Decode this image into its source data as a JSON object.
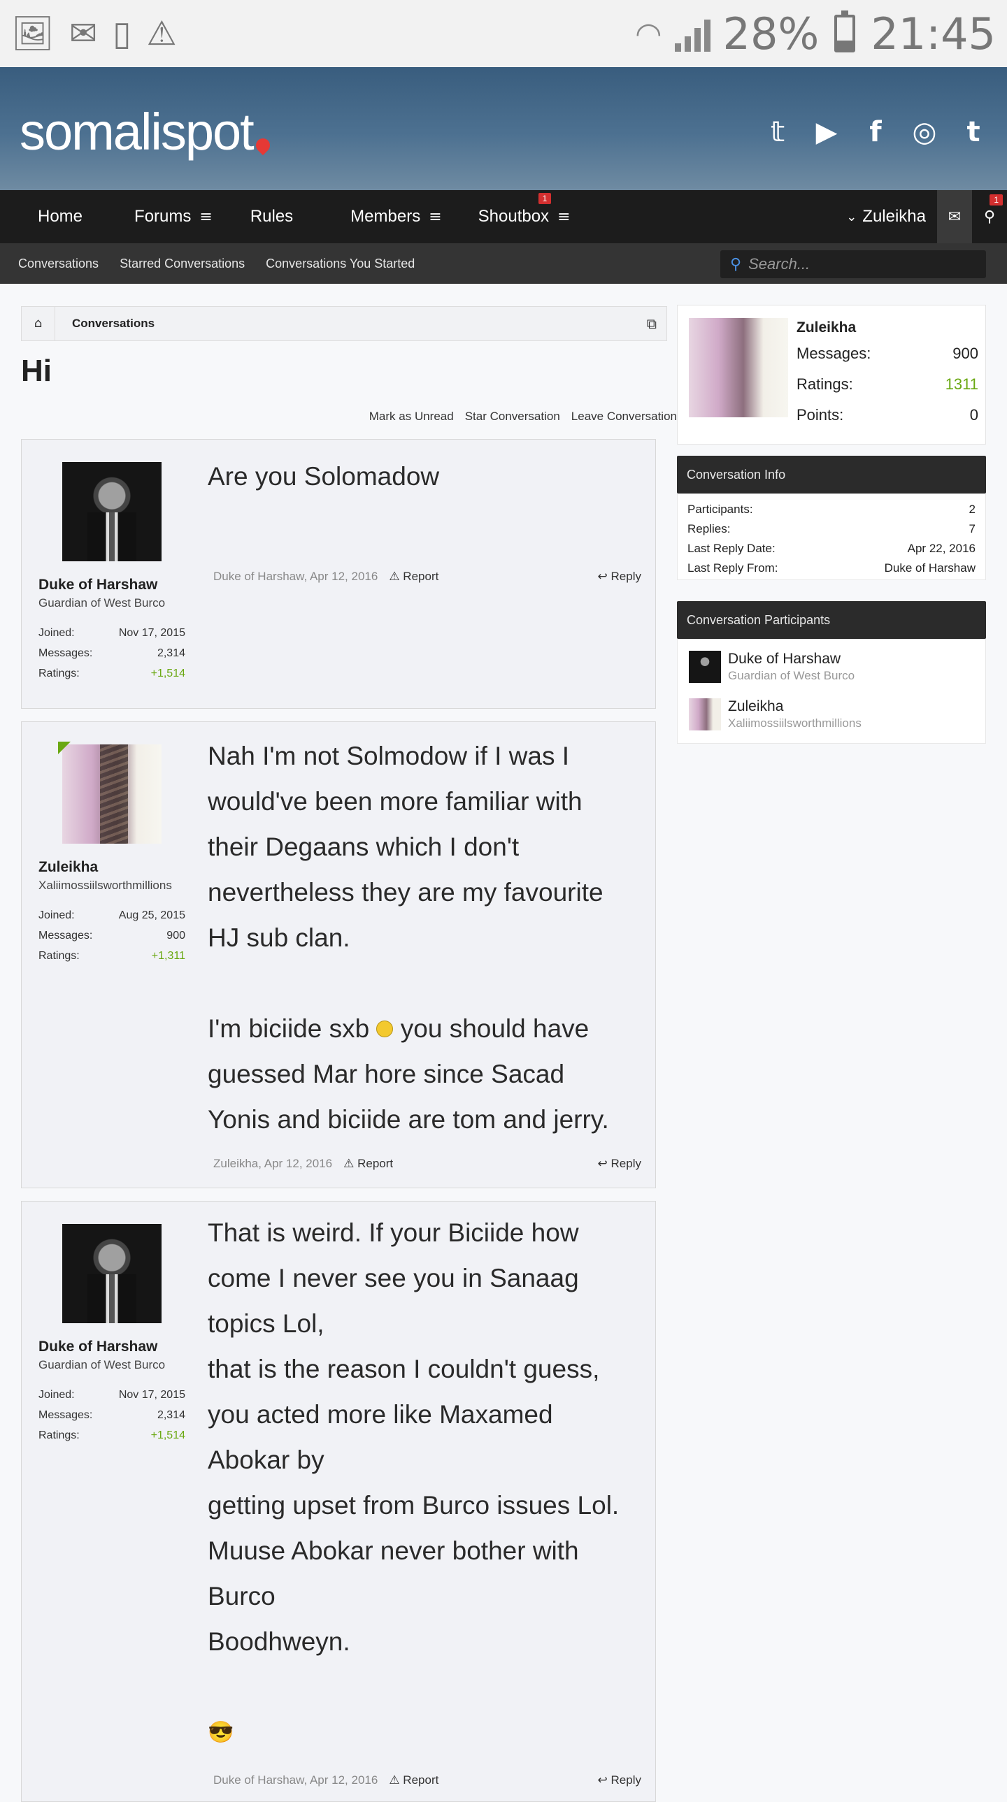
{
  "statusbar": {
    "icons": [
      "image-icon",
      "gmail-icon",
      "phone-clock-icon",
      "warning-icon"
    ],
    "battery": "28%",
    "battery_level": 0.28,
    "time": "21:45"
  },
  "header": {
    "logo": "somalispot",
    "social": [
      "twitter-icon",
      "youtube-icon",
      "facebook-icon",
      "instagram-icon",
      "tumblr-icon"
    ]
  },
  "nav": {
    "items": [
      "Home",
      "Forums",
      "Rules",
      "Members",
      "Shoutbox"
    ],
    "shoutbox_badge": "1",
    "user": "Zuleikha",
    "alerts_badge": "1"
  },
  "subnav": {
    "items": [
      "Conversations",
      "Starred Conversations",
      "Conversations You Started"
    ],
    "search_placeholder": "Search..."
  },
  "breadcrumb": {
    "item": "Conversations"
  },
  "page": {
    "title": "Hi",
    "actions": [
      "Mark as Unread",
      "Star Conversation",
      "Leave Conversation"
    ]
  },
  "posts": [
    {
      "author": "Duke of Harshaw",
      "user_title": "Guardian of West Burco",
      "joined_label": "Joined:",
      "joined": "Nov 17, 2015",
      "messages_label": "Messages:",
      "messages": "2,314",
      "ratings_label": "Ratings:",
      "ratings": "+1,514",
      "lines": [
        "Are you Solomadow"
      ],
      "meta": "Duke of Harshaw, Apr 12, 2016",
      "report": "Report",
      "reply": "Reply"
    },
    {
      "author": "Zuleikha",
      "user_title": "Xaliimossiilsworthmillions",
      "joined_label": "Joined:",
      "joined": "Aug 25, 2015",
      "messages_label": "Messages:",
      "messages": "900",
      "ratings_label": "Ratings:",
      "ratings": "+1,311",
      "lines": [
        "Nah I'm not Solmodow if I was I",
        "would've been more familiar with",
        "their Degaans which I don't",
        "nevertheless they are my favourite",
        "HJ sub clan.",
        "",
        "I'm biciide sxb",
        "guessed Mar hore since Sacad",
        "Yonis and biciide are tom and jerry."
      ],
      "line7_tail": "you should have",
      "meta": "Zuleikha, Apr 12, 2016",
      "report": "Report",
      "reply": "Reply"
    },
    {
      "author": "Duke of Harshaw",
      "user_title": "Guardian of West Burco",
      "joined_label": "Joined:",
      "joined": "Nov 17, 2015",
      "messages_label": "Messages:",
      "messages": "2,314",
      "ratings_label": "Ratings:",
      "ratings": "+1,514",
      "lines": [
        "That is weird. If your Biciide how",
        "come I never see you in Sanaag",
        "topics Lol,",
        "that is the reason I couldn't guess,",
        "you acted more like Maxamed",
        "Abokar by",
        "getting upset from Burco issues Lol.",
        "Muuse Abokar never bother with",
        "Burco",
        "Boodhweyn."
      ],
      "emoji": "😎",
      "meta": "Duke of Harshaw, Apr 12, 2016",
      "report": "Report",
      "reply": "Reply"
    }
  ],
  "sidebar": {
    "profile": {
      "name": "Zuleikha",
      "messages_label": "Messages:",
      "messages": "900",
      "ratings_label": "Ratings:",
      "ratings": "1311",
      "points_label": "Points:",
      "points": "0"
    },
    "info": {
      "heading": "Conversation Info",
      "rows": [
        {
          "label": "Participants:",
          "value": "2"
        },
        {
          "label": "Replies:",
          "value": "7"
        },
        {
          "label": "Last Reply Date:",
          "value": "Apr 22, 2016"
        },
        {
          "label": "Last Reply From:",
          "value": "Duke of Harshaw"
        }
      ]
    },
    "participants": {
      "heading": "Conversation Participants",
      "list": [
        {
          "name": "Duke of Harshaw",
          "title": "Guardian of West Burco"
        },
        {
          "name": "Zuleikha",
          "title": "Xaliimossiilsworthmillions"
        }
      ]
    }
  },
  "colors": {
    "green": "#6aa812",
    "navbar": "#1c1c1c",
    "badge": "#d32f2f"
  }
}
